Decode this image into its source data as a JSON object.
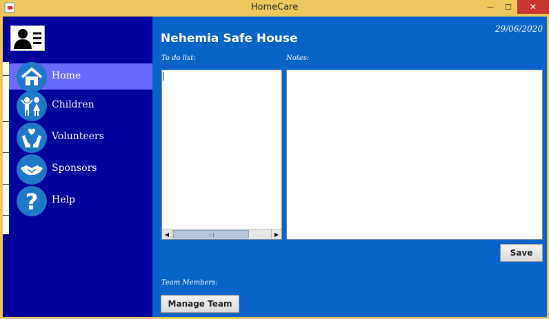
{
  "window": {
    "title": "HomeCare",
    "minimize_glyph": "—",
    "maximize_glyph": "☐",
    "close_glyph": "✕"
  },
  "sidebar": {
    "items": [
      {
        "label": "Home",
        "icon": "home-icon",
        "active": true
      },
      {
        "label": "Children",
        "icon": "children-icon",
        "active": false
      },
      {
        "label": "Volunteers",
        "icon": "volunteers-icon",
        "active": false
      },
      {
        "label": "Sponsors",
        "icon": "sponsors-icon",
        "active": false
      },
      {
        "label": "Help",
        "icon": "help-icon",
        "active": false
      }
    ]
  },
  "main": {
    "title": "Nehemia Safe House",
    "date": "29/06/2020",
    "todo_label": "To do list:",
    "notes_label": "Notes:",
    "save_label": "Save",
    "team_label": "Team Members:",
    "manage_team_label": "Manage Team"
  },
  "colors": {
    "sidebar_bg": "#00009a",
    "active_item": "#6a6aff",
    "main_bg": "#0a64c8",
    "titlebar": "#f0c75e",
    "close_button": "#c7372f"
  }
}
